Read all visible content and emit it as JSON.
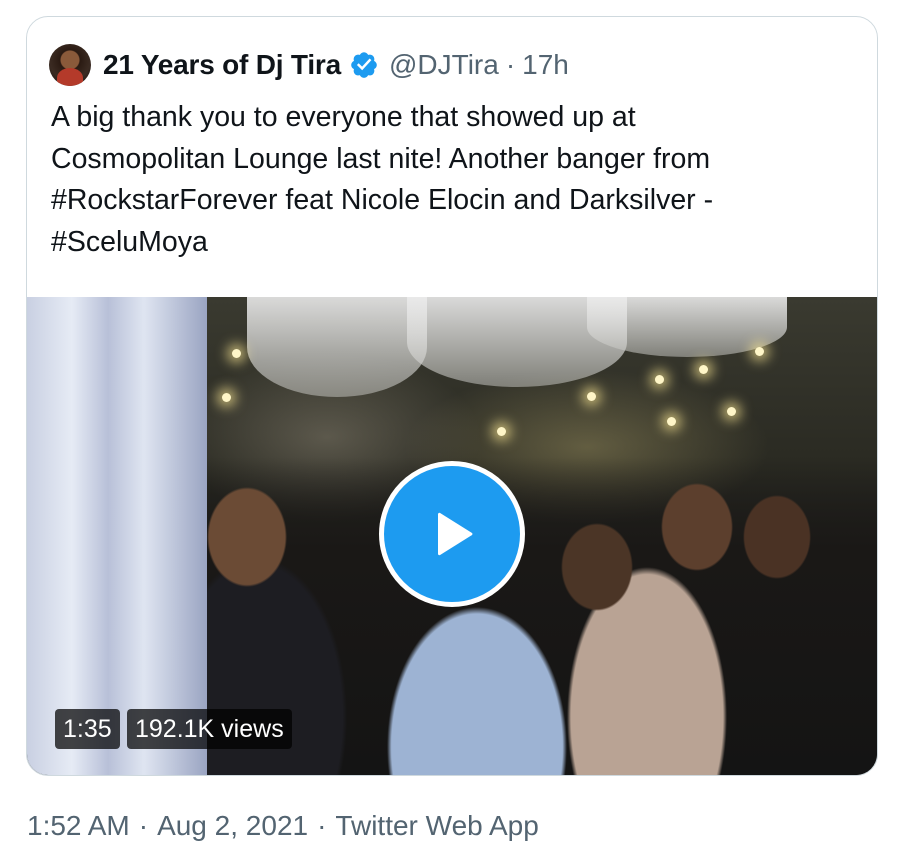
{
  "tweet": {
    "author": {
      "display_name": "21 Years of Dj Tira",
      "handle": "@DJTira",
      "verified": true,
      "avatar_icon": "avatar-photo"
    },
    "separator": "·",
    "time_ago": "17h",
    "text_lines": [
      "A big thank you to everyone that showed up at",
      "Cosmopolitan Lounge last nite! Another banger from",
      "#RockstarForever feat Nicole Elocin and Darksilver -",
      "#SceluMoya"
    ],
    "media": {
      "type": "video",
      "duration": "1:35",
      "views": "192.1K views",
      "play_icon": "play-icon"
    }
  },
  "footer": {
    "time": "1:52 AM",
    "date": "Aug 2, 2021",
    "source": "Twitter Web App",
    "separator": "·"
  },
  "colors": {
    "text_primary": "#0f1419",
    "text_secondary": "#536471",
    "accent": "#1d9bf0",
    "border": "#cfd9de"
  }
}
